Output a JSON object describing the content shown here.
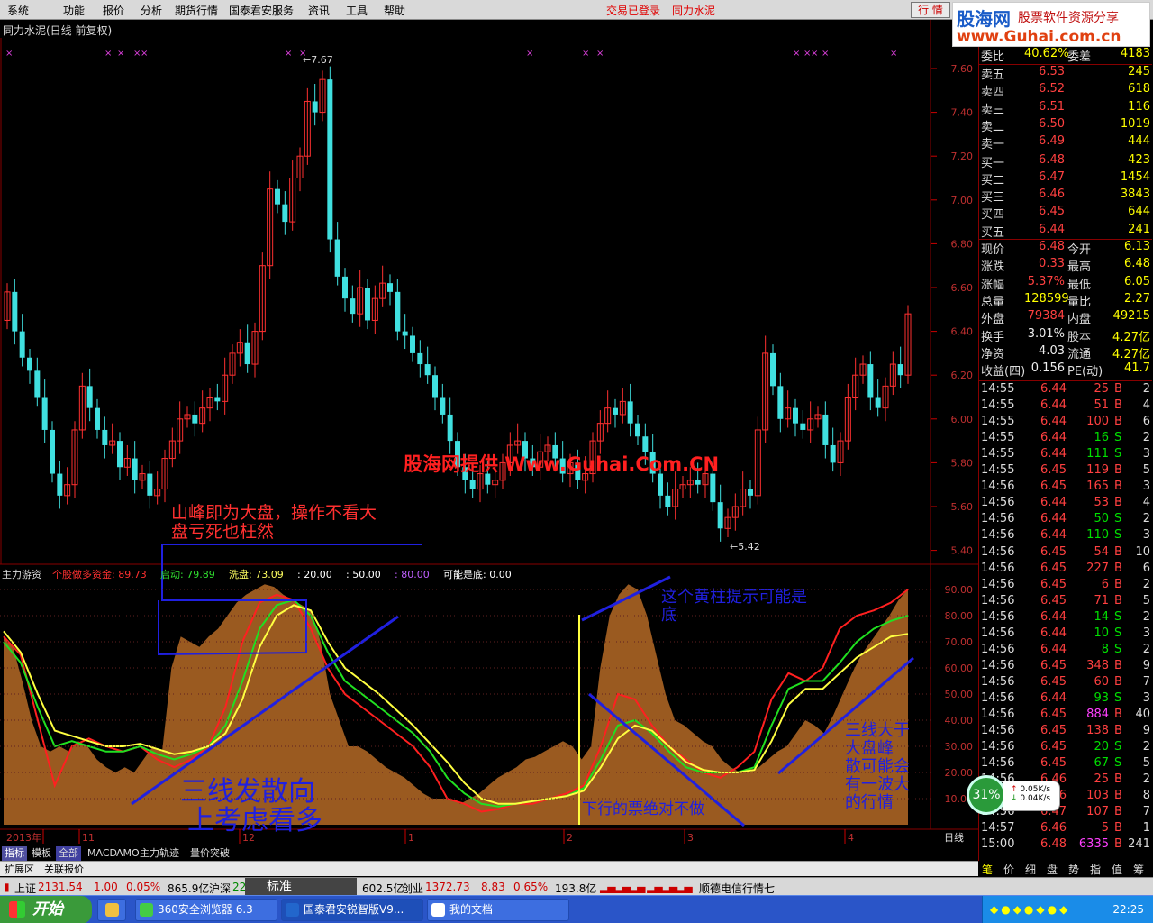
{
  "menu": {
    "items": [
      "系统",
      "功能",
      "报价",
      "分析",
      "期货行情",
      "国泰君安服务",
      "资讯",
      "工具",
      "帮助"
    ],
    "status_login": "交易已登录",
    "status_stock": "同力水泥",
    "quote_button": "行 情"
  },
  "logo": {
    "text_a": "股海网",
    "text_b": "股票软件资源分享",
    "url": "www.Guhai.com.cn"
  },
  "chart": {
    "title": "同力水泥(日线 前复权)",
    "high_label": "7.67",
    "low_label": "5.42",
    "watermark": "股海网提供 Www.Guhai.Com.CN",
    "y_ticks": [
      "7.60",
      "7.40",
      "7.20",
      "7.00",
      "6.80",
      "6.60",
      "6.40",
      "6.20",
      "6.00",
      "5.80",
      "5.60",
      "5.40"
    ],
    "annotation_peak": "山峰即为大盘，操作不看大盘亏死也枉然",
    "annotation_peak_l1": "山峰即为大盘，操作不看大",
    "annotation_peak_l2": "盘亏死也枉然"
  },
  "indicator": {
    "name": "主力游资",
    "legend": [
      {
        "label": "个股做多资金:",
        "value": "89.73",
        "color": "#ff3030"
      },
      {
        "label": "启动:",
        "value": "79.89",
        "color": "#30e030"
      },
      {
        "label": "洗盘:",
        "value": "73.09",
        "color": "#ffff60"
      },
      {
        "label": ":",
        "value": "20.00",
        "color": "#ffffff"
      },
      {
        "label": ":",
        "value": "50.00",
        "color": "#ffffff"
      },
      {
        "label": ":",
        "value": "80.00",
        "color": "#c060ff"
      },
      {
        "label": "可能是底:",
        "value": "0.00",
        "color": "#ffffff"
      }
    ],
    "y_ticks": [
      "90.00",
      "80.00",
      "70.00",
      "60.00",
      "50.00",
      "40.00",
      "30.00",
      "20.00",
      "10.00"
    ],
    "annotation_diverge_l1": "三线发散向",
    "annotation_diverge_l2": "上考虑看多",
    "annotation_yellow_l1": "这个黄柱提示可能是",
    "annotation_yellow_l2": "底",
    "annotation_down": "下行的票绝对不做",
    "annotation_right": "三线大于大盘峰散可能会有一波大的行情"
  },
  "x_axis": {
    "labels": [
      "2013年",
      "11",
      "12",
      "1",
      "2",
      "3",
      "4"
    ],
    "period": "日线"
  },
  "orderbook": {
    "sell": [
      {
        "label": "卖五",
        "price": "6.53",
        "vol": "245"
      },
      {
        "label": "卖四",
        "price": "6.52",
        "vol": "618"
      },
      {
        "label": "卖三",
        "price": "6.51",
        "vol": "116"
      },
      {
        "label": "卖二",
        "price": "6.50",
        "vol": "1019"
      },
      {
        "label": "卖一",
        "price": "6.49",
        "vol": "444"
      }
    ],
    "buy": [
      {
        "label": "买一",
        "price": "6.48",
        "vol": "423"
      },
      {
        "label": "买二",
        "price": "6.47",
        "vol": "1454"
      },
      {
        "label": "买三",
        "price": "6.46",
        "vol": "3843"
      },
      {
        "label": "买四",
        "price": "6.45",
        "vol": "644"
      },
      {
        "label": "买五",
        "price": "6.44",
        "vol": "241"
      }
    ],
    "header_left": "委比",
    "header_left_val": "40.62%",
    "header_right": "委差",
    "header_right_val": "4183"
  },
  "stats": [
    {
      "a": "现价",
      "b": "6.48",
      "bc": "red",
      "c": "今开",
      "d": "6.13",
      "dc": "red"
    },
    {
      "a": "涨跌",
      "b": "0.33",
      "bc": "red",
      "c": "最高",
      "d": "6.48",
      "dc": "red"
    },
    {
      "a": "涨幅",
      "b": "5.37%",
      "bc": "red",
      "c": "最低",
      "d": "6.05",
      "dc": "yellow"
    },
    {
      "a": "总量",
      "b": "128599",
      "bc": "yellow",
      "c": "量比",
      "d": "2.27",
      "dc": "red"
    },
    {
      "a": "外盘",
      "b": "79384",
      "bc": "red",
      "c": "内盘",
      "d": "49215",
      "dc": "green"
    },
    {
      "a": "换手",
      "b": "3.01%",
      "bc": "white",
      "c": "股本",
      "d": "4.27亿",
      "dc": "white"
    },
    {
      "a": "净资",
      "b": "4.03",
      "bc": "white",
      "c": "流通",
      "d": "4.27亿",
      "dc": "white"
    },
    {
      "a": "收益(四)",
      "b": "0.156",
      "bc": "white",
      "c": "PE(动)",
      "d": "41.7",
      "dc": "white"
    }
  ],
  "ticks": [
    {
      "t": "14:55",
      "p": "6.44",
      "v": "25",
      "s": "B",
      "n": "2"
    },
    {
      "t": "14:55",
      "p": "6.44",
      "v": "51",
      "s": "B",
      "n": "4"
    },
    {
      "t": "14:55",
      "p": "6.44",
      "v": "100",
      "s": "B",
      "n": "6"
    },
    {
      "t": "14:55",
      "p": "6.44",
      "v": "16",
      "s": "S",
      "n": "2"
    },
    {
      "t": "14:55",
      "p": "6.44",
      "v": "111",
      "s": "S",
      "n": "3"
    },
    {
      "t": "14:55",
      "p": "6.45",
      "v": "119",
      "s": "B",
      "n": "5"
    },
    {
      "t": "14:56",
      "p": "6.45",
      "v": "165",
      "s": "B",
      "n": "3"
    },
    {
      "t": "14:56",
      "p": "6.44",
      "v": "53",
      "s": "B",
      "n": "4"
    },
    {
      "t": "14:56",
      "p": "6.44",
      "v": "50",
      "s": "S",
      "n": "2"
    },
    {
      "t": "14:56",
      "p": "6.44",
      "v": "110",
      "s": "S",
      "n": "3"
    },
    {
      "t": "14:56",
      "p": "6.45",
      "v": "54",
      "s": "B",
      "n": "10"
    },
    {
      "t": "14:56",
      "p": "6.45",
      "v": "227",
      "s": "B",
      "n": "6"
    },
    {
      "t": "14:56",
      "p": "6.45",
      "v": "6",
      "s": "B",
      "n": "2"
    },
    {
      "t": "14:56",
      "p": "6.45",
      "v": "71",
      "s": "B",
      "n": "5"
    },
    {
      "t": "14:56",
      "p": "6.44",
      "v": "14",
      "s": "S",
      "n": "2"
    },
    {
      "t": "14:56",
      "p": "6.44",
      "v": "10",
      "s": "S",
      "n": "3"
    },
    {
      "t": "14:56",
      "p": "6.44",
      "v": "8",
      "s": "S",
      "n": "2"
    },
    {
      "t": "14:56",
      "p": "6.45",
      "v": "348",
      "s": "B",
      "n": "9"
    },
    {
      "t": "14:56",
      "p": "6.45",
      "v": "60",
      "s": "B",
      "n": "7"
    },
    {
      "t": "14:56",
      "p": "6.44",
      "v": "93",
      "s": "S",
      "n": "3"
    },
    {
      "t": "14:56",
      "p": "6.45",
      "v": "884",
      "s": "B",
      "n": "40"
    },
    {
      "t": "14:56",
      "p": "6.45",
      "v": "138",
      "s": "B",
      "n": "9"
    },
    {
      "t": "14:56",
      "p": "6.45",
      "v": "20",
      "s": "S",
      "n": "2"
    },
    {
      "t": "14:56",
      "p": "6.45",
      "v": "67",
      "s": "S",
      "n": "5"
    },
    {
      "t": "14:56",
      "p": "6.46",
      "v": "25",
      "s": "B",
      "n": "2"
    },
    {
      "t": "14:56",
      "p": "6.46",
      "v": "103",
      "s": "B",
      "n": "8"
    },
    {
      "t": "14:56",
      "p": "6.47",
      "v": "107",
      "s": "B",
      "n": "7"
    },
    {
      "t": "14:57",
      "p": "6.46",
      "v": "5",
      "s": "B",
      "n": "1"
    },
    {
      "t": "15:00",
      "p": "6.48",
      "v": "6335",
      "s": "B",
      "n": "241"
    }
  ],
  "tabs": [
    "指标",
    "模板",
    "全部",
    "MACD",
    "AMO",
    "主力轨迹",
    "量价突破"
  ],
  "tabs2": [
    "扩展区",
    "关联报价"
  ],
  "panel_tabs": [
    "笔",
    "价",
    "细",
    "盘",
    "势",
    "指",
    "值",
    "筹"
  ],
  "statusbar": {
    "sh_label": "上证",
    "sh_val": "2131.54",
    "sh_chg": "1.00",
    "sh_pct": "0.05%",
    "sh_amt": "865.9亿",
    "sz_label": "沪深",
    "sz_val": "22",
    "std": "标准",
    "amt2": "602.5亿",
    "cy_label": "创业",
    "cy_val": "1372.73",
    "cy_chg": "8.83",
    "cy_pct": "0.65%",
    "cy_amt": "193.8亿",
    "news": "顺德电信行情七"
  },
  "taskbar": {
    "start": "开始",
    "items": [
      "360安全浏览器 6.3",
      "国泰君安锐智版V9...",
      "我的文档"
    ],
    "clock": "22:25"
  },
  "speed": {
    "pct": "31%",
    "up": "0.05K/s",
    "down": "0.04K/s"
  },
  "colors": {
    "up": "#ff3030",
    "down": "#40e0e0",
    "area": "#9a5a20",
    "annot": "#2020e0"
  }
}
